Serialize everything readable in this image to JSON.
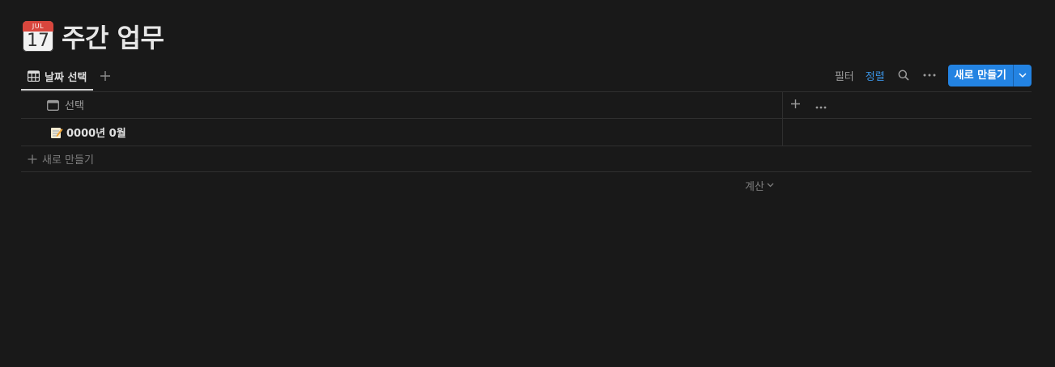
{
  "page": {
    "title": "주간 업무",
    "emoji": {
      "month": "JUL",
      "day": "17"
    }
  },
  "toolbar": {
    "view_tab_label": "날짜 선택",
    "filter_label": "필터",
    "sort_label": "정렬",
    "new_button_label": "새로 만들기"
  },
  "table": {
    "column_header": "선택",
    "rows": [
      {
        "title": "0000년 0월"
      }
    ],
    "new_row_label": "새로 만들기",
    "calc_label": "계산"
  },
  "colors": {
    "background": "#191919",
    "accent": "#2383e2",
    "active_text": "#3a91e0"
  }
}
